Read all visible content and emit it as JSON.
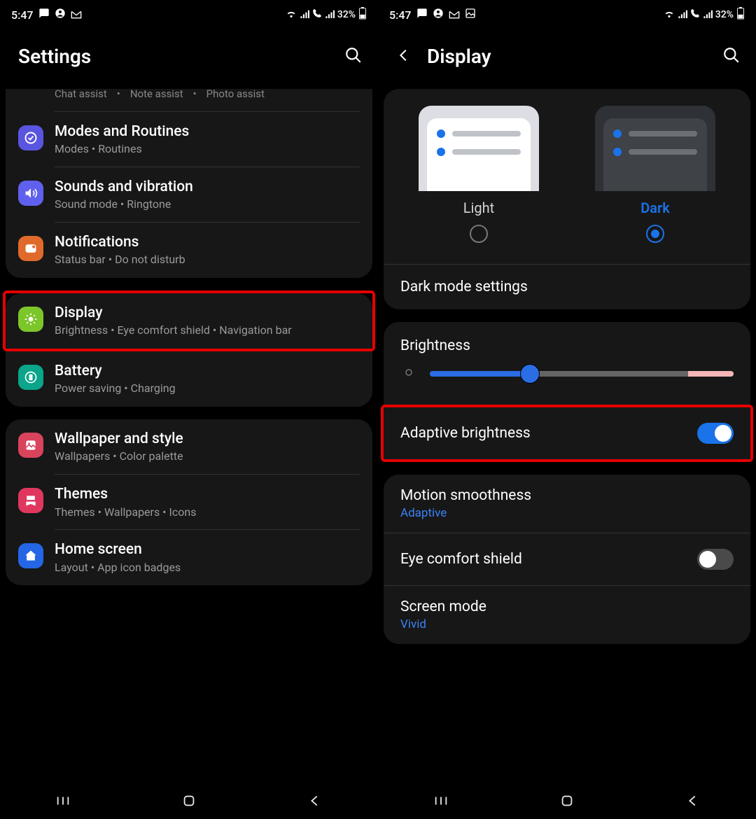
{
  "status": {
    "time": "5:47",
    "battery": "32%"
  },
  "left": {
    "title": "Settings",
    "partial_row": {
      "a": "Chat assist",
      "b": "Note assist",
      "c": "Photo assist"
    },
    "items": [
      {
        "icon": "modes",
        "color": "#5a55e0",
        "label": "Modes and Routines",
        "sub": "Modes  •  Routines"
      },
      {
        "icon": "sound",
        "color": "#6060ee",
        "label": "Sounds and vibration",
        "sub": "Sound mode  •  Ringtone"
      },
      {
        "icon": "notif",
        "color": "#e06a2b",
        "label": "Notifications",
        "sub": "Status bar  •  Do not disturb"
      }
    ],
    "display": {
      "icon": "display",
      "color": "#7cc62a",
      "label": "Display",
      "sub": "Brightness  •  Eye comfort shield  •  Navigation bar"
    },
    "battery": {
      "icon": "battery",
      "color": "#0aa58a",
      "label": "Battery",
      "sub": "Power saving  •  Charging"
    },
    "items3": [
      {
        "icon": "wallpaper",
        "color": "#d9435c",
        "label": "Wallpaper and style",
        "sub": "Wallpapers  •  Color palette"
      },
      {
        "icon": "themes",
        "color": "#e0375f",
        "label": "Themes",
        "sub": "Themes  •  Wallpapers  •  Icons"
      },
      {
        "icon": "home",
        "color": "#2466e6",
        "label": "Home screen",
        "sub": "Layout  •  App icon badges"
      }
    ]
  },
  "right": {
    "title": "Display",
    "light": "Light",
    "dark": "Dark",
    "darkmode": "Dark mode settings",
    "brightness": "Brightness",
    "adaptive": "Adaptive brightness",
    "motion": {
      "label": "Motion smoothness",
      "val": "Adaptive"
    },
    "eye": "Eye comfort shield",
    "screenmode": {
      "label": "Screen mode",
      "val": "Vivid"
    }
  }
}
